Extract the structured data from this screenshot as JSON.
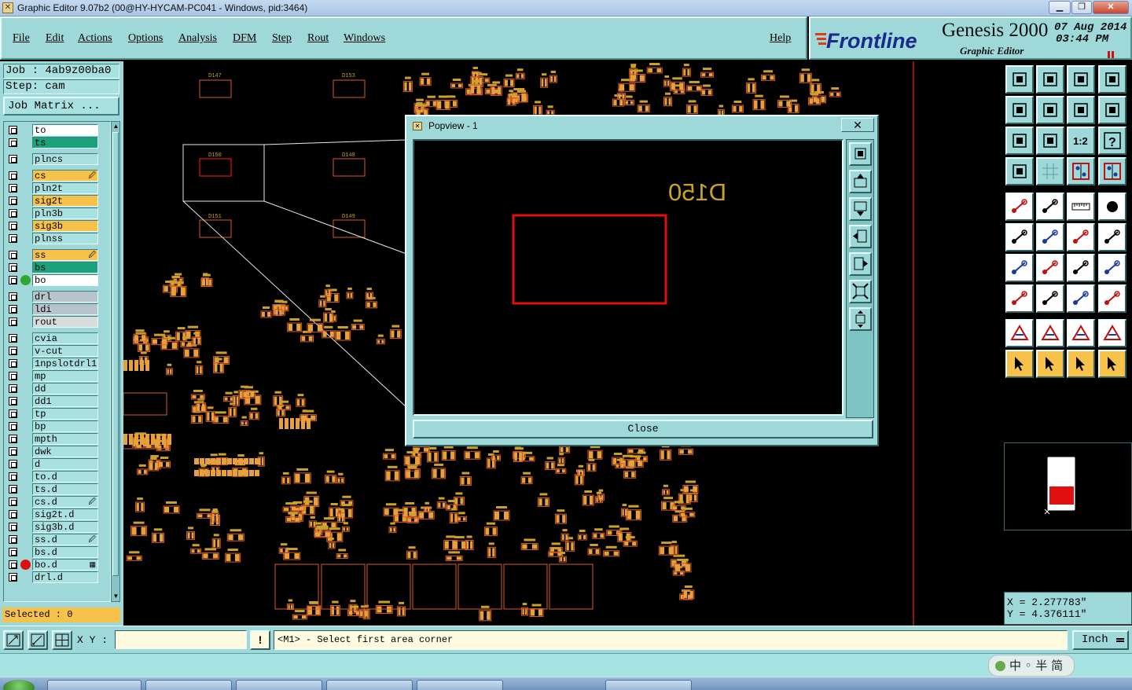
{
  "window": {
    "title": "Graphic Editor 9.07b2 (00@HY-HYCAM-PC041 - Windows, pid:3464)",
    "controls": {
      "minimize": "▁",
      "restore": "❐",
      "close": "✕"
    }
  },
  "menu": {
    "items": [
      "File",
      "Edit",
      "Actions",
      "Options",
      "Analysis",
      "DFM",
      "Step",
      "Rout",
      "Windows"
    ],
    "help": "Help"
  },
  "logo": {
    "brand": "Frontline",
    "product": "Genesis 2000",
    "subtitle": "Graphic Editor",
    "date": "07 Aug 2014",
    "time": "03:44 PM"
  },
  "job": {
    "job_line": "Job : 4ab9z00ba0",
    "step_line": "Step: cam",
    "matrix_button": "Job Matrix ..."
  },
  "layers": [
    {
      "name": "to",
      "color": "#ffffff"
    },
    {
      "name": "ts",
      "color": "#1aa37a"
    },
    {
      "name": "plncs",
      "color": "#a9e1e1"
    },
    {
      "name": "cs",
      "color": "#f6c24a",
      "mark": "🖉"
    },
    {
      "name": "pln2t",
      "color": "#a9e1e1"
    },
    {
      "name": "sig2t",
      "color": "#f6c24a"
    },
    {
      "name": "pln3b",
      "color": "#a9e1e1"
    },
    {
      "name": "sig3b",
      "color": "#f6c24a"
    },
    {
      "name": "plnss",
      "color": "#a9e1e1"
    },
    {
      "name": "ss",
      "color": "#f6c24a",
      "mark": "🖉"
    },
    {
      "name": "bs",
      "color": "#1aa37a"
    },
    {
      "name": "bo",
      "color": "#ffffff",
      "dot": "#2fa82f"
    },
    {
      "name": "drl",
      "color": "#b8c4cc"
    },
    {
      "name": "ldi",
      "color": "#b8c4cc"
    },
    {
      "name": "rout",
      "color": "#d8dcdc"
    },
    {
      "name": "cvia",
      "color": "#a9e1e1"
    },
    {
      "name": "v-cut",
      "color": "#a9e1e1"
    },
    {
      "name": "1npslotdrl1",
      "color": "#a9e1e1"
    },
    {
      "name": "mp",
      "color": "#a9e1e1"
    },
    {
      "name": "dd",
      "color": "#a9e1e1"
    },
    {
      "name": "dd1",
      "color": "#a9e1e1"
    },
    {
      "name": "tp",
      "color": "#a9e1e1"
    },
    {
      "name": "bp",
      "color": "#a9e1e1"
    },
    {
      "name": "mpth",
      "color": "#a9e1e1"
    },
    {
      "name": "dwk",
      "color": "#a9e1e1"
    },
    {
      "name": "d",
      "color": "#a9e1e1"
    },
    {
      "name": "to.d",
      "color": "#a9e1e1"
    },
    {
      "name": "ts.d",
      "color": "#a9e1e1"
    },
    {
      "name": "cs.d",
      "color": "#a9e1e1",
      "mark": "🖉"
    },
    {
      "name": "sig2t.d",
      "color": "#a9e1e1"
    },
    {
      "name": "sig3b.d",
      "color": "#a9e1e1"
    },
    {
      "name": "ss.d",
      "color": "#a9e1e1",
      "mark": "🖉"
    },
    {
      "name": "bs.d",
      "color": "#a9e1e1"
    },
    {
      "name": "bo.d",
      "color": "#a9e1e1",
      "dot": "#e01010",
      "mark": "▦"
    },
    {
      "name": "drl.d",
      "color": "#a9e1e1"
    }
  ],
  "status": {
    "selected": "Selected : 0",
    "xy_label": "X Y :",
    "xy_value": "",
    "warn": "!",
    "prompt": "<M1> - Select first area corner",
    "units": "Inch"
  },
  "popview": {
    "title": "Popview - 1",
    "close_x": "✕",
    "close_button": "Close",
    "component_label": "D150"
  },
  "coords": {
    "x": "X = 2.277783\"",
    "y": "Y = 4.376111\""
  },
  "canvas_labels": {
    "d147": "D147",
    "d153": "D153",
    "d150": "D150",
    "d148": "D148",
    "d151": "D151",
    "d149": "D149"
  },
  "ime": "中 ◦ 半 简",
  "colors": {
    "panel": "#9fd8d8",
    "pad": "#e8a03a",
    "outline": "#d85a2a",
    "highlight": "#e01010",
    "label": "#c9a227"
  }
}
